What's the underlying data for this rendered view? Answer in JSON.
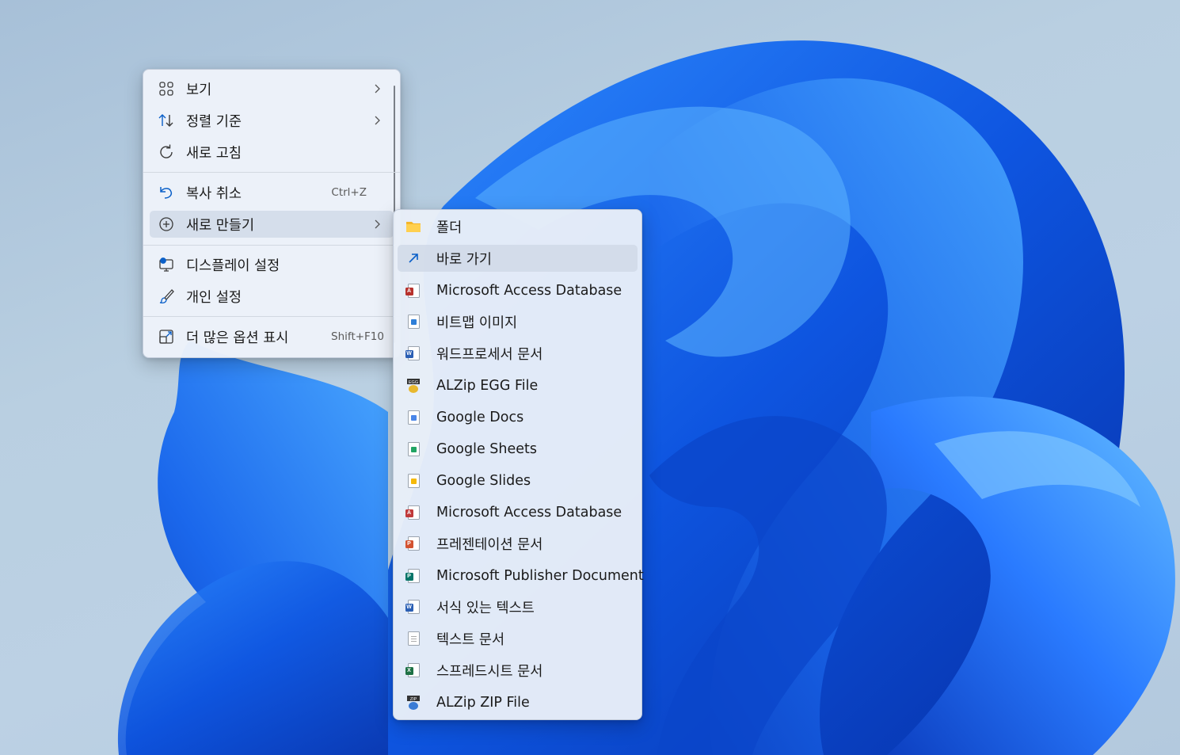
{
  "desktop": {
    "context_menu": {
      "items": [
        {
          "label": "보기",
          "icon": "view-grid-icon",
          "submenu": true
        },
        {
          "label": "정렬 기준",
          "icon": "sort-icon",
          "submenu": true
        },
        {
          "label": "새로 고침",
          "icon": "refresh-icon"
        },
        {
          "label": "복사 취소",
          "icon": "undo-icon",
          "shortcut": "Ctrl+Z"
        },
        {
          "label": "새로 만들기",
          "icon": "new-plus-icon",
          "submenu": true
        },
        {
          "label": "디스플레이 설정",
          "icon": "display-settings-icon"
        },
        {
          "label": "개인 설정",
          "icon": "brush-icon"
        },
        {
          "label": "더 많은 옵션 표시",
          "icon": "more-options-icon",
          "shortcut": "Shift+F10"
        }
      ]
    },
    "new_submenu": {
      "items": [
        {
          "label": "폴더",
          "icon": "folder-icon"
        },
        {
          "label": "바로 가기",
          "icon": "shortcut-arrow-icon"
        },
        {
          "label": "Microsoft Access Database",
          "icon": "access-file-icon"
        },
        {
          "label": "비트맵 이미지",
          "icon": "bitmap-file-icon"
        },
        {
          "label": "워드프로세서 문서",
          "icon": "word-file-icon"
        },
        {
          "label": "ALZip EGG File",
          "icon": "alzip-egg-icon"
        },
        {
          "label": "Google Docs",
          "icon": "google-docs-icon"
        },
        {
          "label": "Google Sheets",
          "icon": "google-sheets-icon"
        },
        {
          "label": "Google Slides",
          "icon": "google-slides-icon"
        },
        {
          "label": "Microsoft Access Database",
          "icon": "access-file-icon"
        },
        {
          "label": "프레젠테이션 문서",
          "icon": "powerpoint-file-icon"
        },
        {
          "label": "Microsoft Publisher Document",
          "icon": "publisher-file-icon"
        },
        {
          "label": "서식 있는 텍스트",
          "icon": "rich-text-file-icon"
        },
        {
          "label": "텍스트 문서",
          "icon": "text-file-icon"
        },
        {
          "label": "스프레드시트 문서",
          "icon": "excel-file-icon"
        },
        {
          "label": "ALZip ZIP File",
          "icon": "alzip-zip-icon"
        }
      ]
    },
    "colors": {
      "menu_background": "#eef3fa",
      "hover_background": "#cdd7e6",
      "accent_blue": "#0a5fc8",
      "wallpaper_blue": "#1565e8"
    }
  }
}
